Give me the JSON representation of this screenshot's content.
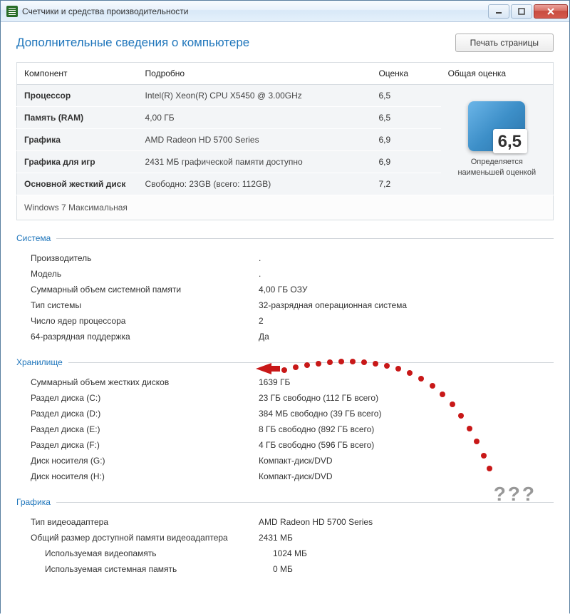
{
  "window": {
    "title": "Счетчики и средства производительности"
  },
  "header": {
    "title": "Дополнительные сведения о компьютере",
    "print_btn": "Печать страницы"
  },
  "table": {
    "cols": {
      "component": "Компонент",
      "detail": "Подробно",
      "score": "Оценка",
      "overall": "Общая оценка"
    },
    "rows": [
      {
        "label": "Процессор",
        "detail": "Intel(R) Xeon(R) CPU X5450 @ 3.00GHz",
        "score": "6,5"
      },
      {
        "label": "Память (RAM)",
        "detail": "4,00 ГБ",
        "score": "6,5"
      },
      {
        "label": "Графика",
        "detail": "AMD Radeon HD 5700 Series",
        "score": "6,9"
      },
      {
        "label": "Графика для игр",
        "detail": "2431 МБ графической памяти доступно",
        "score": "6,9"
      },
      {
        "label": "Основной жесткий диск",
        "detail": "Свободно: 23GB (всего: 112GB)",
        "score": "7,2"
      }
    ],
    "overall_score": "6,5",
    "overall_text": "Определяется наименьшей оценкой",
    "os": "Windows 7 Максимальная"
  },
  "sections": {
    "system": {
      "title": "Система",
      "rows": [
        {
          "label": "Производитель",
          "value": "."
        },
        {
          "label": "Модель",
          "value": "."
        },
        {
          "label": "Суммарный объем системной памяти",
          "value": "4,00 ГБ ОЗУ"
        },
        {
          "label": "Тип системы",
          "value": "32-разрядная операционная система"
        },
        {
          "label": "Число ядер процессора",
          "value": "2"
        },
        {
          "label": "64-разрядная поддержка",
          "value": "Да"
        }
      ]
    },
    "storage": {
      "title": "Хранилище",
      "rows": [
        {
          "label": "Суммарный объем жестких дисков",
          "value": "1639 ГБ"
        },
        {
          "label": "Раздел диска (C:)",
          "value": "23 ГБ свободно (112 ГБ всего)"
        },
        {
          "label": "Раздел диска (D:)",
          "value": "384 МБ свободно (39 ГБ всего)"
        },
        {
          "label": "Раздел диска (E:)",
          "value": "8 ГБ свободно (892 ГБ всего)"
        },
        {
          "label": "Раздел диска (F:)",
          "value": "4 ГБ свободно (596 ГБ всего)"
        },
        {
          "label": "Диск носителя (G:)",
          "value": "Компакт-диск/DVD"
        },
        {
          "label": "Диск носителя (H:)",
          "value": "Компакт-диск/DVD"
        }
      ]
    },
    "graphics": {
      "title": "Графика",
      "rows": [
        {
          "label": "Тип видеоадаптера",
          "value": "AMD Radeon HD 5700 Series",
          "indent": false
        },
        {
          "label": "Общий размер доступной памяти видеоадаптера",
          "value": "2431 МБ",
          "indent": false
        },
        {
          "label": "Используемая видеопамять",
          "value": "1024 МБ",
          "indent": true
        },
        {
          "label": "Используемая системная память",
          "value": "0 МБ",
          "indent": true
        }
      ]
    }
  },
  "annotation": {
    "text": "???"
  }
}
